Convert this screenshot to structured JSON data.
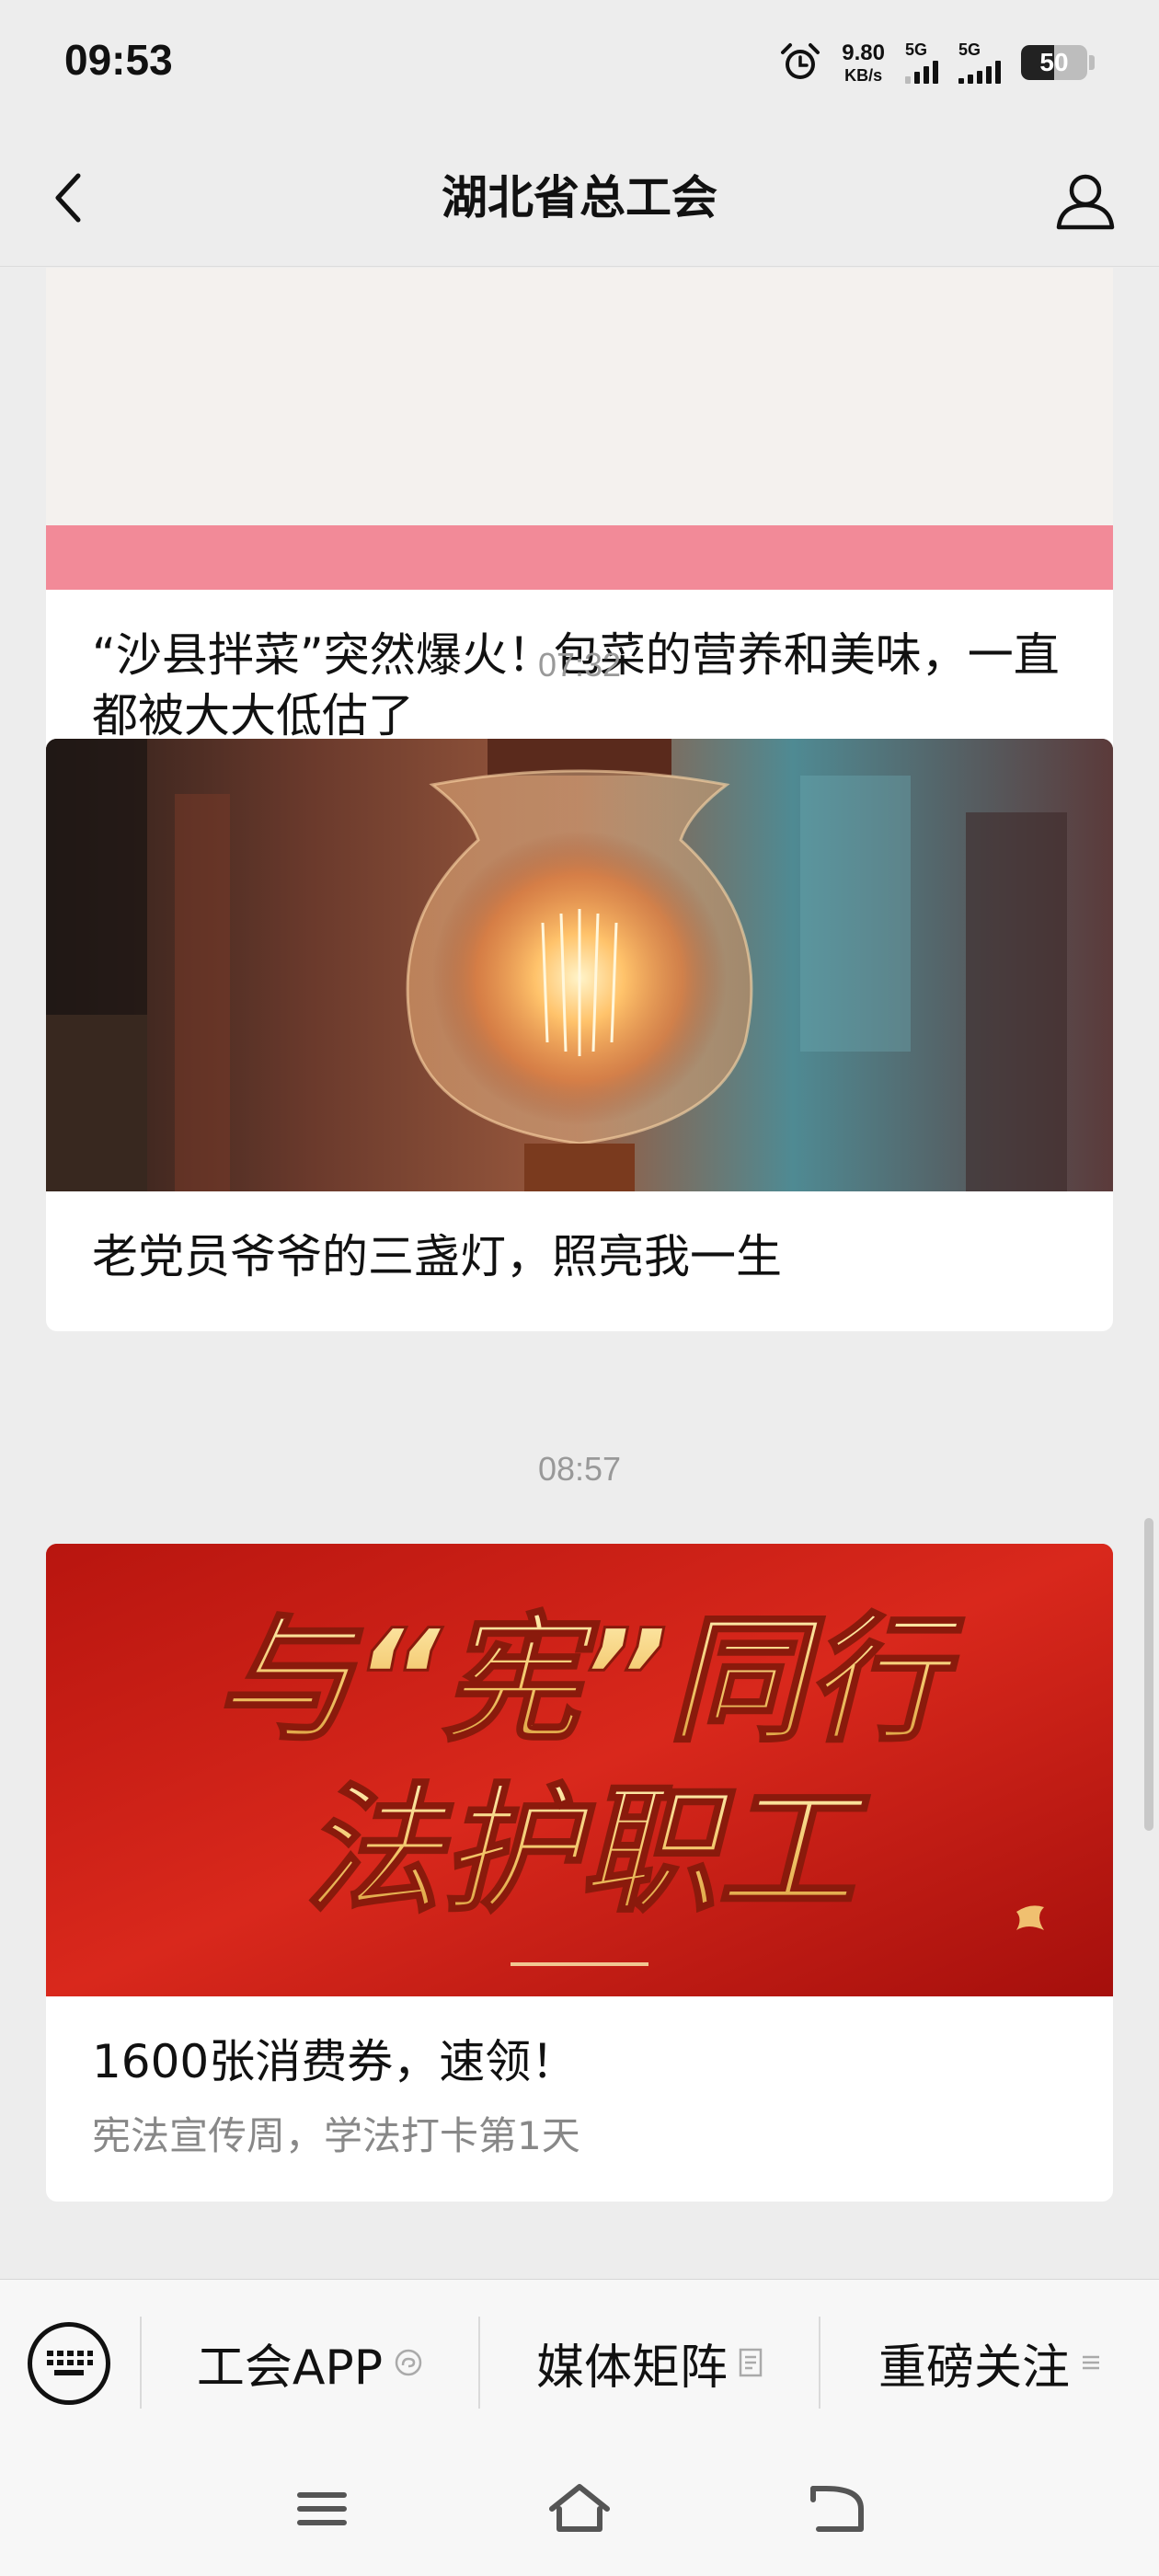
{
  "status_bar": {
    "time": "09:53",
    "net_speed_value": "9.80",
    "net_speed_unit": "KB/s",
    "sim1_label": "5G",
    "sim2_label": "5G",
    "battery": "50",
    "battery_level": 0.5
  },
  "nav": {
    "title": "湖北省总工会"
  },
  "feed": {
    "articles": [
      {
        "title": "“沙县拌菜”突然爆火！包菜的营养和美味，一直都被大大低估了"
      },
      {
        "timestamp": "07:32",
        "title": "老党员爷爷的三盏灯，照亮我一生"
      },
      {
        "timestamp": "08:57",
        "banner_line1": "与“宪”同行",
        "banner_line2": "法护职工",
        "title": "1600张消费券，速领！",
        "subtitle": "宪法宣传周，学法打卡第1天"
      }
    ]
  },
  "bottom_menu": {
    "items": [
      {
        "label": "工会APP",
        "icon": "mini-program-icon"
      },
      {
        "label": "媒体矩阵",
        "icon": "document-icon"
      },
      {
        "label": "重磅关注",
        "icon": "menu-lines-icon"
      }
    ]
  },
  "colors": {
    "background": "#ededed",
    "card": "#ffffff",
    "banner_red": "#c8231c",
    "banner_gold": "#f3d27a",
    "pink_strip": "#f28a98"
  }
}
